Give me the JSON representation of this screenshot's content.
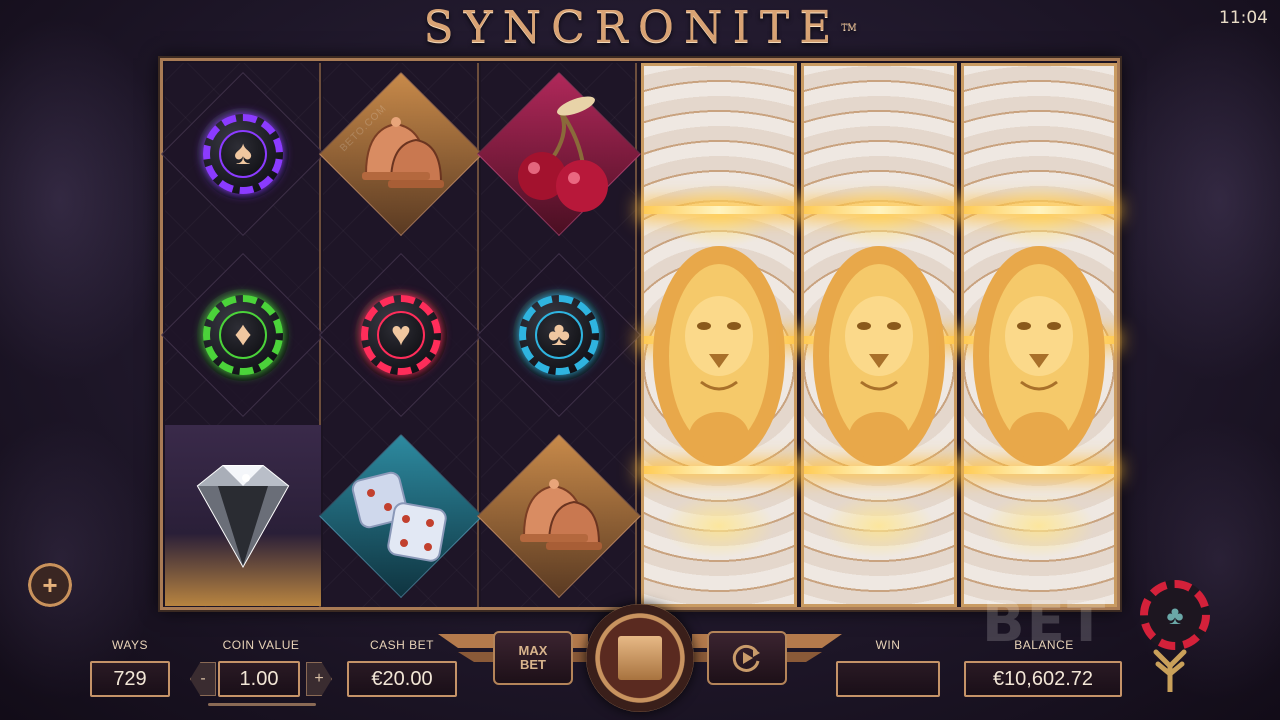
{
  "header": {
    "title": "SYNCRONITE",
    "tm": "TM",
    "clock": "11:04"
  },
  "watermark": "BETO.COM",
  "reels": {
    "reel1": [
      "purple-spade-chip",
      "green-diamond-chip",
      "diamond-gem"
    ],
    "reel2": [
      "bells",
      "red-heart-chip",
      "dice"
    ],
    "reel3": [
      "cherries",
      "blue-club-chip",
      "bells"
    ],
    "wild_reels": [
      "lion-wild",
      "lion-wild",
      "lion-wild"
    ],
    "suits": {
      "spade": "♠",
      "diamond": "♦",
      "heart": "♥",
      "club": "♣"
    }
  },
  "controls": {
    "ways_label": "WAYS",
    "ways_value": "729",
    "coin_value_label": "COIN VALUE",
    "coin_value": "1.00",
    "coin_minus": "-",
    "coin_plus": "+",
    "cash_bet_label": "CASH BET",
    "cash_bet_value": "€20.00",
    "max_bet_label": "MAX BET",
    "win_label": "WIN",
    "win_value": "",
    "balance_label": "BALANCE",
    "balance_value": "€10,602.72",
    "plus_icon": "+"
  },
  "branding": {
    "beto_text": "BET"
  },
  "colors": {
    "accent": "#c59368",
    "chip_purple": "#8b3bff",
    "chip_green": "#4bd33a",
    "chip_red": "#ff2d5a",
    "chip_blue": "#2fb4e0",
    "gold_glow": "#ffcb55"
  }
}
